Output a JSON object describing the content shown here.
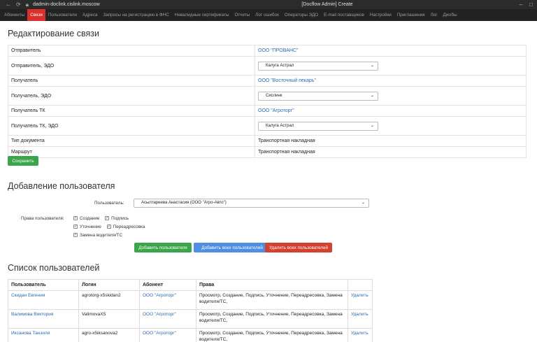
{
  "titlebar": {
    "url": "dadmin-doclink.cislink.moscow",
    "title": "[Docflow Admin] Create"
  },
  "nav": [
    "Абоненты",
    "Связи",
    "Пользователи",
    "Адреса",
    "Запросы на регистрацию в ФНС",
    "Невалидные сертификаты",
    "Отчеты",
    "Лог ошибок",
    "Операторы ЭДО",
    "E-mail поставщиков",
    "Настройки",
    "Приглашения",
    "Лог",
    "Джобы"
  ],
  "nav_active": "Связи",
  "edit": {
    "heading": "Редактирование связи",
    "rows": {
      "sender_label": "Отправитель",
      "sender_value": "ООО \"ПРОВАНС\"",
      "sender_edo_label": "Отправитель, ЭДО",
      "sender_edo_value": "Калуга Астрал",
      "receiver_label": "Получатель",
      "receiver_value": "ООО \"Восточный пекарь\"",
      "receiver_edo_label": "Получатель, ЭДО",
      "receiver_edo_value": "Сислинк",
      "receiver_tk_label": "Получатель ТК",
      "receiver_tk_value": "ООО \"Агроторг\"",
      "receiver_tk_edo_label": "Получатель ТК, ЭДО",
      "receiver_tk_edo_value": "Калуга Астрал",
      "doctype_label": "Тип документа",
      "doctype_value": "Транспортная накладная",
      "route_label": "Маршрут",
      "route_value": "Транспортная накладная"
    },
    "save_label": "Сохранить"
  },
  "add_user": {
    "heading": "Добавление пользователя",
    "user_label": "Пользователь:",
    "user_value": "Асылтареева Анастасия (ООО \"Агро-Авто\")",
    "rights_label": "Права пользователя:",
    "rights": [
      "Создание",
      "Подпись",
      "Уточнение",
      "Переадресовка",
      "Замена водителя/ТС"
    ],
    "btn_add": "Добавить пользователя",
    "btn_add_all": "Добавить всех пользователей",
    "btn_remove_all": "Удалить всех пользователей"
  },
  "users": {
    "heading": "Список пользователей",
    "columns": [
      "Пользователь",
      "Логин",
      "Абонент",
      "Права",
      ""
    ],
    "rows": [
      {
        "name": "Скидан Евгения",
        "login": "agrotorg-x5skidan2",
        "subscriber": "ООО \"Агроторг\"",
        "rights": "Просмотр, Создание, Подпись, Уточнение, Переадресовка, Замена водителя/ТС,",
        "action": "Удалить"
      },
      {
        "name": "Валимова Виктория",
        "login": "ValimovaX5",
        "subscriber": "ООО \"Агроторг\"",
        "rights": "Просмотр, Создание, Подпись, Уточнение, Переадресовка, Замена водителя/ТС,",
        "action": "Удалить"
      },
      {
        "name": "Иксанова Танзиля",
        "login": "agro-x5iksanova2",
        "subscriber": "ООО \"Агроторг\"",
        "rights": "Просмотр, Создание, Подпись, Уточнение, Переадресовка, Замена водителя/ТС,",
        "action": "Удалить"
      }
    ]
  },
  "colors": {
    "accent": "#d9302c",
    "link": "#2a6ab3",
    "green": "#3aa54a",
    "blue": "#4f8ee3",
    "red": "#d3412f"
  }
}
